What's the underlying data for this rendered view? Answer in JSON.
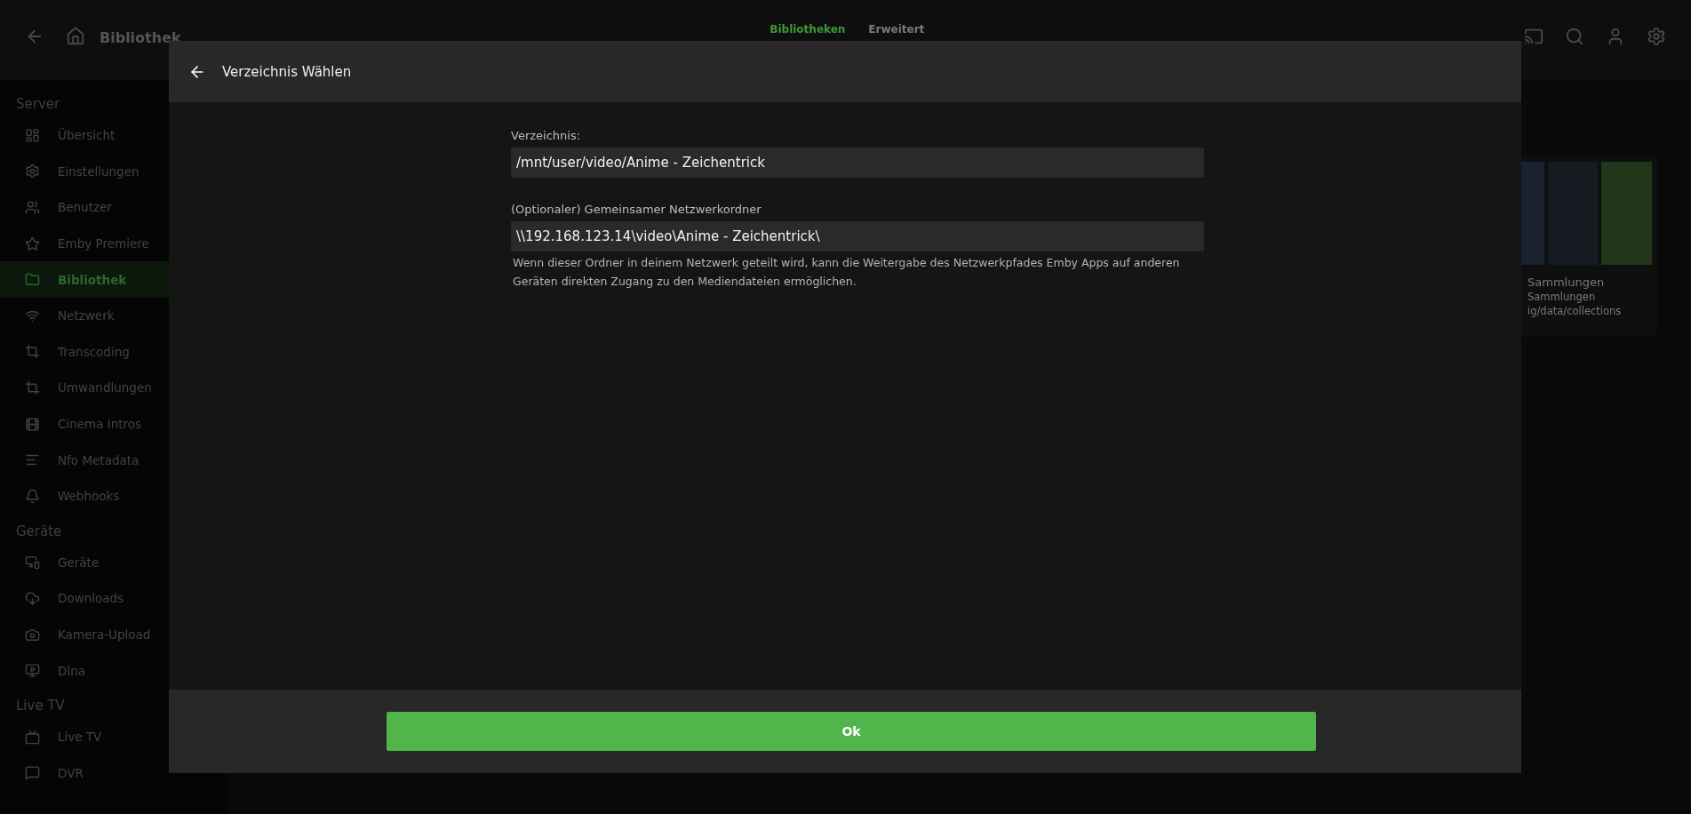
{
  "header": {
    "title": "Bibliothek",
    "tabs": [
      {
        "label": "Bibliotheken",
        "selected": true
      },
      {
        "label": "Erweitert",
        "selected": false
      }
    ]
  },
  "sidebar": {
    "sections": [
      {
        "title": "Server",
        "items": [
          {
            "label": "Übersicht",
            "selected": false
          },
          {
            "label": "Einstellungen",
            "selected": false
          },
          {
            "label": "Benutzer",
            "selected": false
          },
          {
            "label": "Emby Premiere",
            "selected": false
          },
          {
            "label": "Bibliothek",
            "selected": true
          },
          {
            "label": "Netzwerk",
            "selected": false
          },
          {
            "label": "Transcoding",
            "selected": false
          },
          {
            "label": "Umwandlungen",
            "selected": false
          },
          {
            "label": "Cinema Intros",
            "selected": false
          },
          {
            "label": "Nfo Metadata",
            "selected": false
          },
          {
            "label": "Webhooks",
            "selected": false
          }
        ]
      },
      {
        "title": "Geräte",
        "items": [
          {
            "label": "Geräte",
            "selected": false
          },
          {
            "label": "Downloads",
            "selected": false
          },
          {
            "label": "Kamera-Upload",
            "selected": false
          },
          {
            "label": "Dlna",
            "selected": false
          }
        ]
      },
      {
        "title": "Live TV",
        "items": [
          {
            "label": "Live TV",
            "selected": false
          },
          {
            "label": "DVR",
            "selected": false
          }
        ]
      }
    ]
  },
  "library_card": {
    "title": "Sammlungen",
    "subtitle": "Sammlungen",
    "path": "ig/data/collections"
  },
  "dialog": {
    "title": "Verzeichnis Wählen",
    "fields": [
      {
        "label": "Verzeichnis:",
        "value": "/mnt/user/video/Anime - Zeichentrick"
      },
      {
        "label": "(Optionaler) Gemeinsamer Netzwerkordner",
        "value": "\\\\192.168.123.14\\video\\Anime - Zeichentrick\\",
        "help": "Wenn dieser Ordner in deinem Netzwerk geteilt wird, kann die Weitergabe des Netzwerkpfades Emby Apps auf anderen Geräten direkten Zugang zu den Mediendateien ermöglichen."
      }
    ],
    "ok_button": "Ok"
  }
}
